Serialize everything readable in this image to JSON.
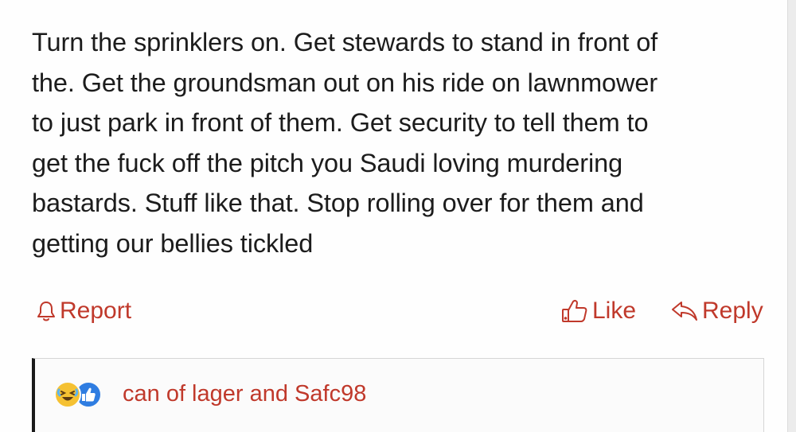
{
  "post": {
    "lines": [
      "Turn the sprinklers on. Get stewards to stand in front of",
      "the. Get the groundsman out on his ride on lawnmower",
      "to just park in front of them. Get security to tell them to",
      "get the fuck off the pitch you Saudi loving murdering",
      "bastards. Stuff like that. Stop rolling over for them and",
      "getting our bellies tickled"
    ]
  },
  "actions": {
    "report_label": "Report",
    "like_label": "Like",
    "reply_label": "Reply"
  },
  "reactions": {
    "icons": [
      "laughing-emoji-icon",
      "thumbs-up-icon"
    ],
    "names": "can of lager and Safc98"
  },
  "colors": {
    "accent": "#c0392b",
    "text": "#1c1c1c",
    "background": "#fefefe"
  }
}
